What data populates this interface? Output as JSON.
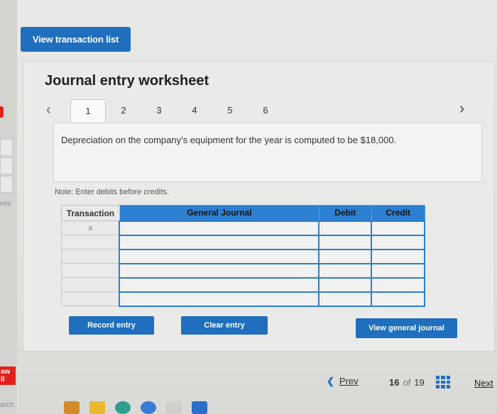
{
  "header": {
    "view_transaction_list_label": "View transaction list"
  },
  "worksheet": {
    "title": "Journal entry worksheet",
    "tabs": [
      "1",
      "2",
      "3",
      "4",
      "5",
      "6"
    ],
    "active_tab": "1",
    "description": "Depreciation on the company's equipment for the year is computed to be $18,000.",
    "note": "Note: Enter debits before credits.",
    "table": {
      "columns": [
        "Transaction",
        "General Journal",
        "Debit",
        "Credit"
      ],
      "rows": [
        {
          "transaction": "a",
          "account": "",
          "debit": "",
          "credit": ""
        },
        {
          "transaction": "",
          "account": "",
          "debit": "",
          "credit": ""
        },
        {
          "transaction": "",
          "account": "",
          "debit": "",
          "credit": ""
        },
        {
          "transaction": "",
          "account": "",
          "debit": "",
          "credit": ""
        },
        {
          "transaction": "",
          "account": "",
          "debit": "",
          "credit": ""
        },
        {
          "transaction": "",
          "account": "",
          "debit": "",
          "credit": ""
        }
      ]
    },
    "buttons": {
      "record_entry": "Record entry",
      "clear_entry": "Clear entry",
      "view_general_journal": "View general journal"
    }
  },
  "footer": {
    "prev_label": "Prev",
    "current_page": "16",
    "of_label": "of",
    "total_pages": "19",
    "next_label": "Next"
  },
  "left_edge": {
    "text_1": "ces",
    "badge": "aw\nll",
    "text_2": "arch"
  },
  "colors": {
    "accent": "#1f6fbe",
    "table_header": "#2c7fd1"
  }
}
